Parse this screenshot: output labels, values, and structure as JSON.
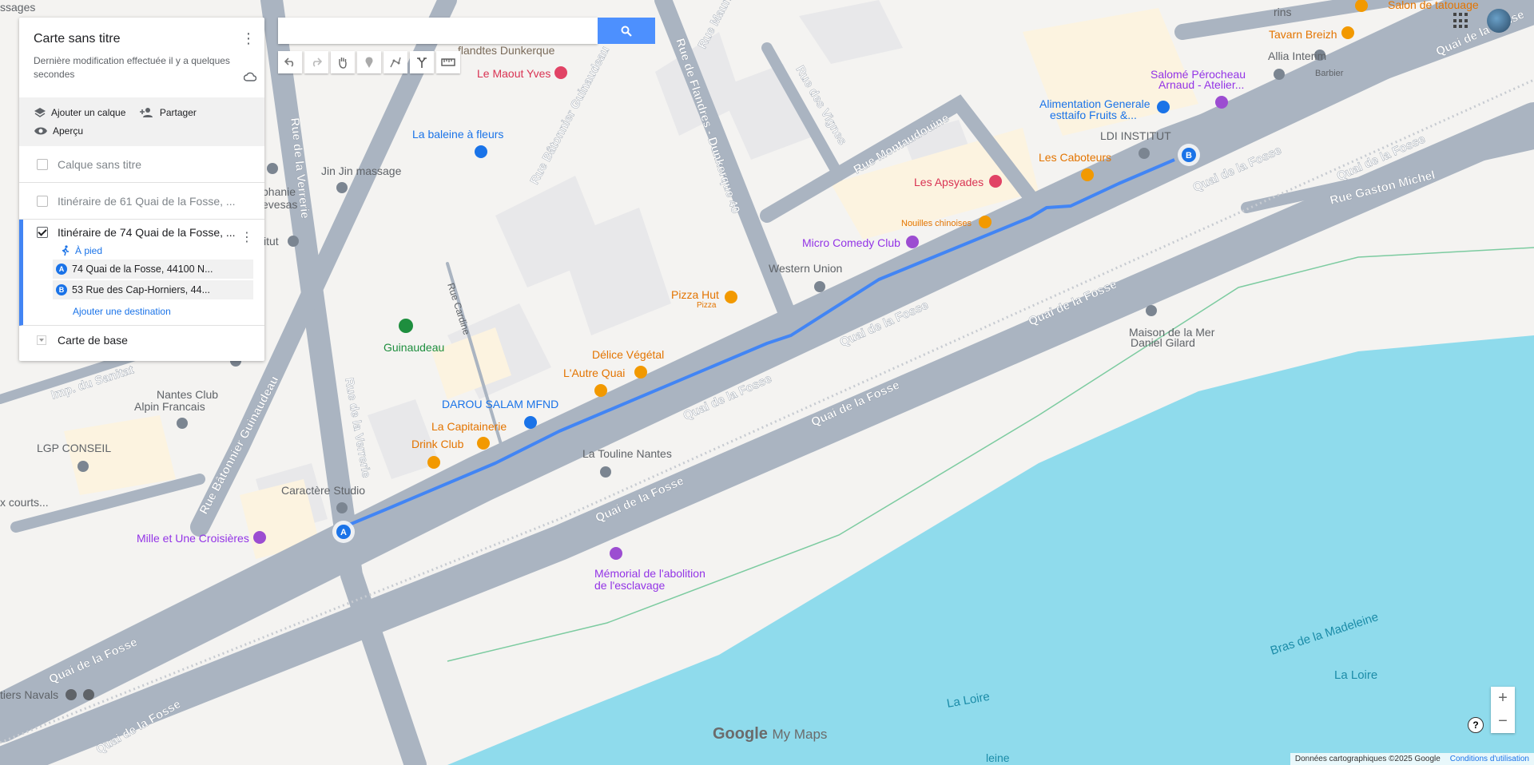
{
  "panel": {
    "title": "Carte sans titre",
    "last_edit": "Dernière modification effectuée il y a quelques secondes",
    "actions": {
      "add_layer": "Ajouter un calque",
      "share": "Partager",
      "preview": "Aperçu"
    },
    "layers": [
      {
        "label": "Calque sans titre",
        "checked": false
      },
      {
        "label": "Itinéraire de 61 Quai de la Fosse, ...",
        "checked": false
      }
    ],
    "active_layer": {
      "label": "Itinéraire de 74 Quai de la Fosse, ...",
      "checked": true,
      "mode": "À pied",
      "destinations": [
        {
          "marker": "A",
          "address": "74 Quai de la Fosse, 44100 N..."
        },
        {
          "marker": "B",
          "address": "53 Rue des Cap-Horniers, 44..."
        }
      ],
      "add_destination": "Ajouter une destination"
    },
    "base_map": "Carte de base"
  },
  "search": {
    "value": "",
    "placeholder": ""
  },
  "toolbar": [
    "undo-icon",
    "redo-icon",
    "hand-icon",
    "marker-icon",
    "draw-line-icon",
    "directions-icon",
    "ruler-icon"
  ],
  "map_labels": {
    "streets": [
      "Rue de la Verrerie",
      "Rue de la Verrerie",
      "Rue Bâtonnier Guinaudeau",
      "Rue Bâtonnier Guinaudeau",
      "Rue de Flandres - Dunkerque 40",
      "Rue des Vignes",
      "Rue Montaudouine",
      "Rue Cardine",
      "Quai de la Fosse",
      "Quai de la Fosse",
      "Quai de la Fosse",
      "Quai de la Fosse",
      "Quai de la Fosse",
      "Quai de la Fosse",
      "Quai de la Fosse",
      "Quai de la Fosse",
      "Quai de la Fosse",
      "Quai de la Fosse",
      "Quai de la Fosse",
      "Quai de la Fosse",
      "Rue Gaston Michel",
      "Imp. du Sanitat",
      "Rue Mauric",
      "Bras de la Madeleine",
      "La Loire",
      "La Loire"
    ],
    "places": {
      "le_maout": "Le Maout Yves",
      "flandtes": "flandtes Dunkerque",
      "baleine": "La baleine à fleurs",
      "jinjin": "Jin Jin massage",
      "phanie": "phanie",
      "evesas": "evesas",
      "itut": "itut",
      "guinaudeau": "Guinaudeau",
      "nantes_club_1": "Nantes Club",
      "nantes_club_2": "Alpin Francais",
      "lgp": "LGP CONSEIL",
      "courts": "x courts...",
      "mille": "Mille et Une Croisières",
      "caractere": "Caractère Studio",
      "darou": "DAROU SALAM MFND",
      "capitainerie": "La Capitainerie",
      "drink": "Drink Club",
      "autre_quai": "L'Autre Quai",
      "delice": "Délice Végétal",
      "pizza": "Pizza Hut",
      "pizza_sub": "Pizza",
      "touline": "La Touline Nantes",
      "memorial_1": "Mémorial de l'abolition",
      "memorial_2": "de l'esclavage",
      "western": "Western Union",
      "micro": "Micro Comedy Club",
      "nouilles": "Nouilles chinoises",
      "apsyades": "Les Apsyades",
      "caboteurs": "Les Caboteurs",
      "ldi": "LDI INSTITUT",
      "alim_1": "Alimentation Generale",
      "alim_2": "esttaifo Fruits &...",
      "salome_1": "Salomé Pérocheau",
      "salome_2": "Arnaud - Atelier...",
      "allia": "Allia Interim",
      "barbier": "Barbier",
      "tavarn": "Tavarn Breizh",
      "tatouage": "Salon de tatouage",
      "maison_1": "Maison de la Mer",
      "maison_2": "Daniel Gilard",
      "navals": "tiers Navals",
      "ssages": "ssages",
      "rins": "rins",
      "leine": "leine"
    },
    "markers": {
      "a": "A",
      "b": "B"
    }
  },
  "zoom": {
    "in": "+",
    "out": "−"
  },
  "help": "?",
  "logo": {
    "google": "Google",
    "product": "My Maps"
  },
  "footer": {
    "attribution": "Données cartographiques ©2025 Google",
    "terms": "Conditions d'utilisation"
  },
  "colors": {
    "route": "#4285f4",
    "water": "#8fdbec",
    "road": "#aab4c1",
    "land": "#f4f3f1"
  }
}
